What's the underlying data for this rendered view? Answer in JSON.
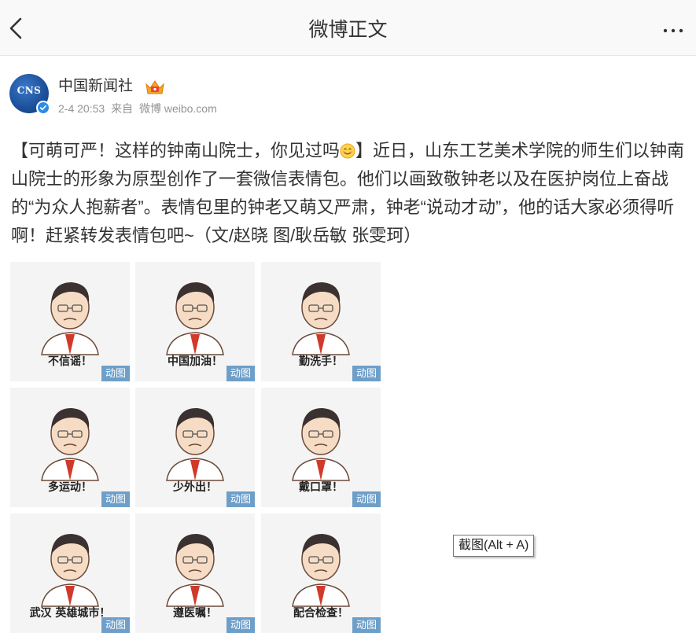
{
  "nav": {
    "back_icon": "chevron-left-icon",
    "title": "微博正文",
    "more_icon": "more-dots-icon"
  },
  "post": {
    "author": "中国新闻社",
    "avatar_text": "CNS",
    "member_icon": "crown-icon",
    "verified_icon": "verified-badge-icon",
    "date": "2-4 20:53",
    "source_prefix": "来自",
    "source": "微博 weibo.com",
    "text_part1": "【可萌可严！这样的钟南山院士，你见过吗",
    "emoji_icon": "smile-emoji-icon",
    "text_part2": "】近日，山东工艺美术学院的师生们以钟南山院士的形象为原型创作了一套微信表情包。他们以画致敬钟老以及在医护岗位上奋战的“为众人抱薪者”。表情包里的钟老又萌又严肃，钟老“说动才动”，他的话大家必须得听啊！赶紧转发表情包吧~（文/赵晓 图/耿岳敏 张雯珂）"
  },
  "images": [
    {
      "caption": "不信谣！",
      "badge": "动图"
    },
    {
      "caption": "中国加油！",
      "badge": "动图"
    },
    {
      "caption": "勤洗手！",
      "badge": "动图"
    },
    {
      "caption": "多运动！",
      "badge": "动图"
    },
    {
      "caption": "少外出！",
      "badge": "动图"
    },
    {
      "caption": "戴口罩！",
      "badge": "动图"
    },
    {
      "caption": "武汉 英雄城市！",
      "badge": "动图"
    },
    {
      "caption": "遵医嘱！",
      "badge": "动图"
    },
    {
      "caption": "配合检查！",
      "badge": "动图"
    }
  ],
  "tooltip": "截图(Alt + A)",
  "colors": {
    "nav_bg": "#f9f9f9",
    "badge_bg": "#6e9fc9",
    "meta_text": "#939393",
    "verified": "#2b8be6"
  }
}
